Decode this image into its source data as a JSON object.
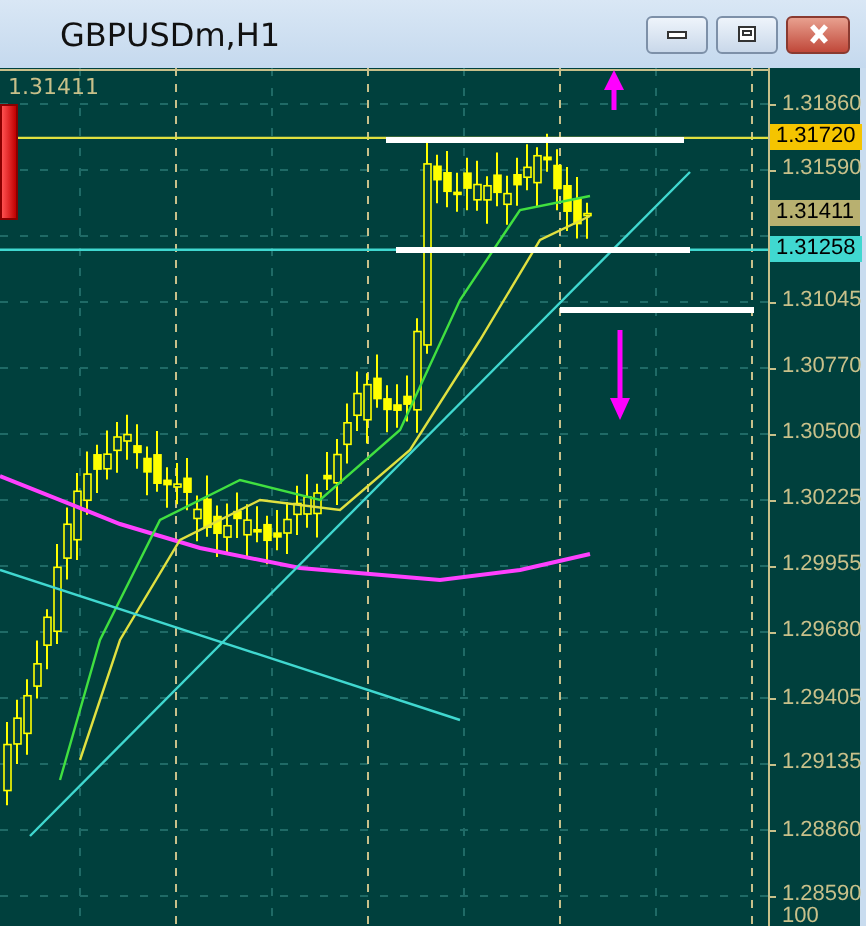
{
  "window": {
    "title": "GBPUSDm,H1",
    "buttons": [
      {
        "kind": "minimize"
      },
      {
        "kind": "maximize"
      },
      {
        "kind": "close"
      }
    ]
  },
  "chart": {
    "bid_label": "1.31411",
    "axis": [
      {
        "text": "1.31860",
        "kind": "tick"
      },
      {
        "text": "1.31720",
        "kind": "tag",
        "color": "#f5c400"
      },
      {
        "text": "1.31590",
        "kind": "tick"
      },
      {
        "text": "1.31411",
        "kind": "tag",
        "color": "#b8b070"
      },
      {
        "text": "1.31258",
        "kind": "tag",
        "color": "#40d8d0"
      },
      {
        "text": "1.31045",
        "kind": "tick"
      },
      {
        "text": "1.30770",
        "kind": "tick"
      },
      {
        "text": "1.30500",
        "kind": "tick"
      },
      {
        "text": "1.30225",
        "kind": "tick"
      },
      {
        "text": "1.29955",
        "kind": "tick"
      },
      {
        "text": "1.29680",
        "kind": "tick"
      },
      {
        "text": "1.29405",
        "kind": "tick"
      },
      {
        "text": "1.29135",
        "kind": "tick"
      },
      {
        "text": "1.28860",
        "kind": "tick"
      },
      {
        "text": "1.28590",
        "kind": "tick"
      }
    ],
    "indicator_level": "100"
  }
}
